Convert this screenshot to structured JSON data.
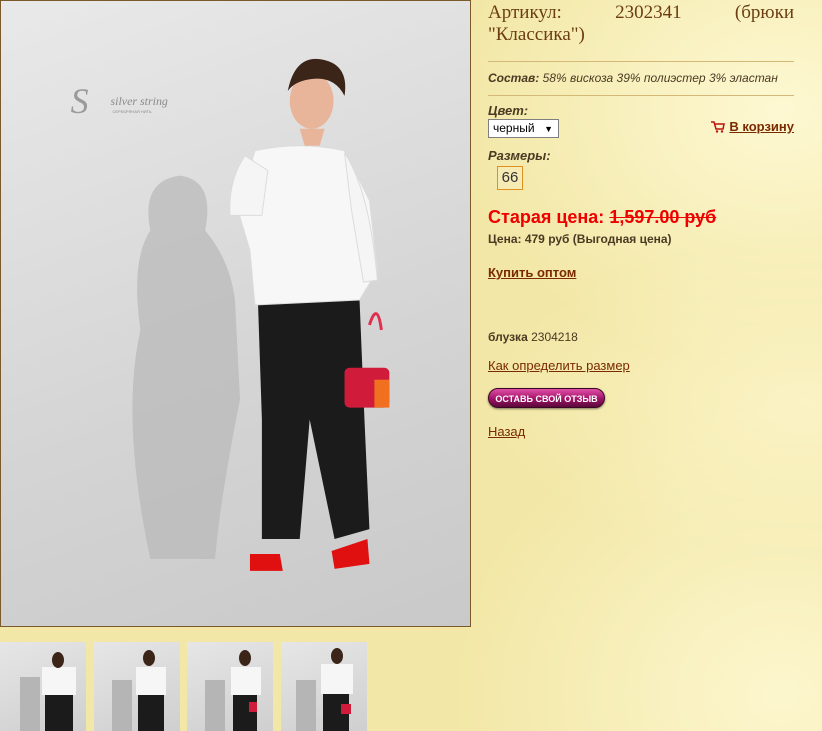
{
  "product": {
    "title_line1_left": "Артикул:",
    "title_line1_mid": "2302341",
    "title_line1_right": "(брюки",
    "title_line2": "\"Классика\")",
    "composition_label": "Состав:",
    "composition_text": "58% вискоза 39% полиэстер 3% эластан",
    "color_label": "Цвет:",
    "color_value": "черный",
    "cart_label": "В корзину",
    "sizes_label": "Размеры:",
    "size_value": "66",
    "old_price_label": "Старая цена:",
    "old_price_value": "1,597.00 руб",
    "price_text": "Цена: 479 руб (Выгодная цена)",
    "wholesale_link": "Купить оптом",
    "blouse_label": "блузка",
    "blouse_code": "2304218",
    "size_guide_link": "Как определить размер",
    "review_button": "ОСТАВЬ СВОЙ ОТЗЫВ",
    "back_link": "Назад"
  },
  "photo": {
    "logo_text": "silver string",
    "logo_subtext": "СЕРЕБРЯНАЯ НИТЬ"
  },
  "colors": {
    "link": "#7a2a00",
    "old_price": "#ee0000",
    "title": "#6b3d12"
  }
}
